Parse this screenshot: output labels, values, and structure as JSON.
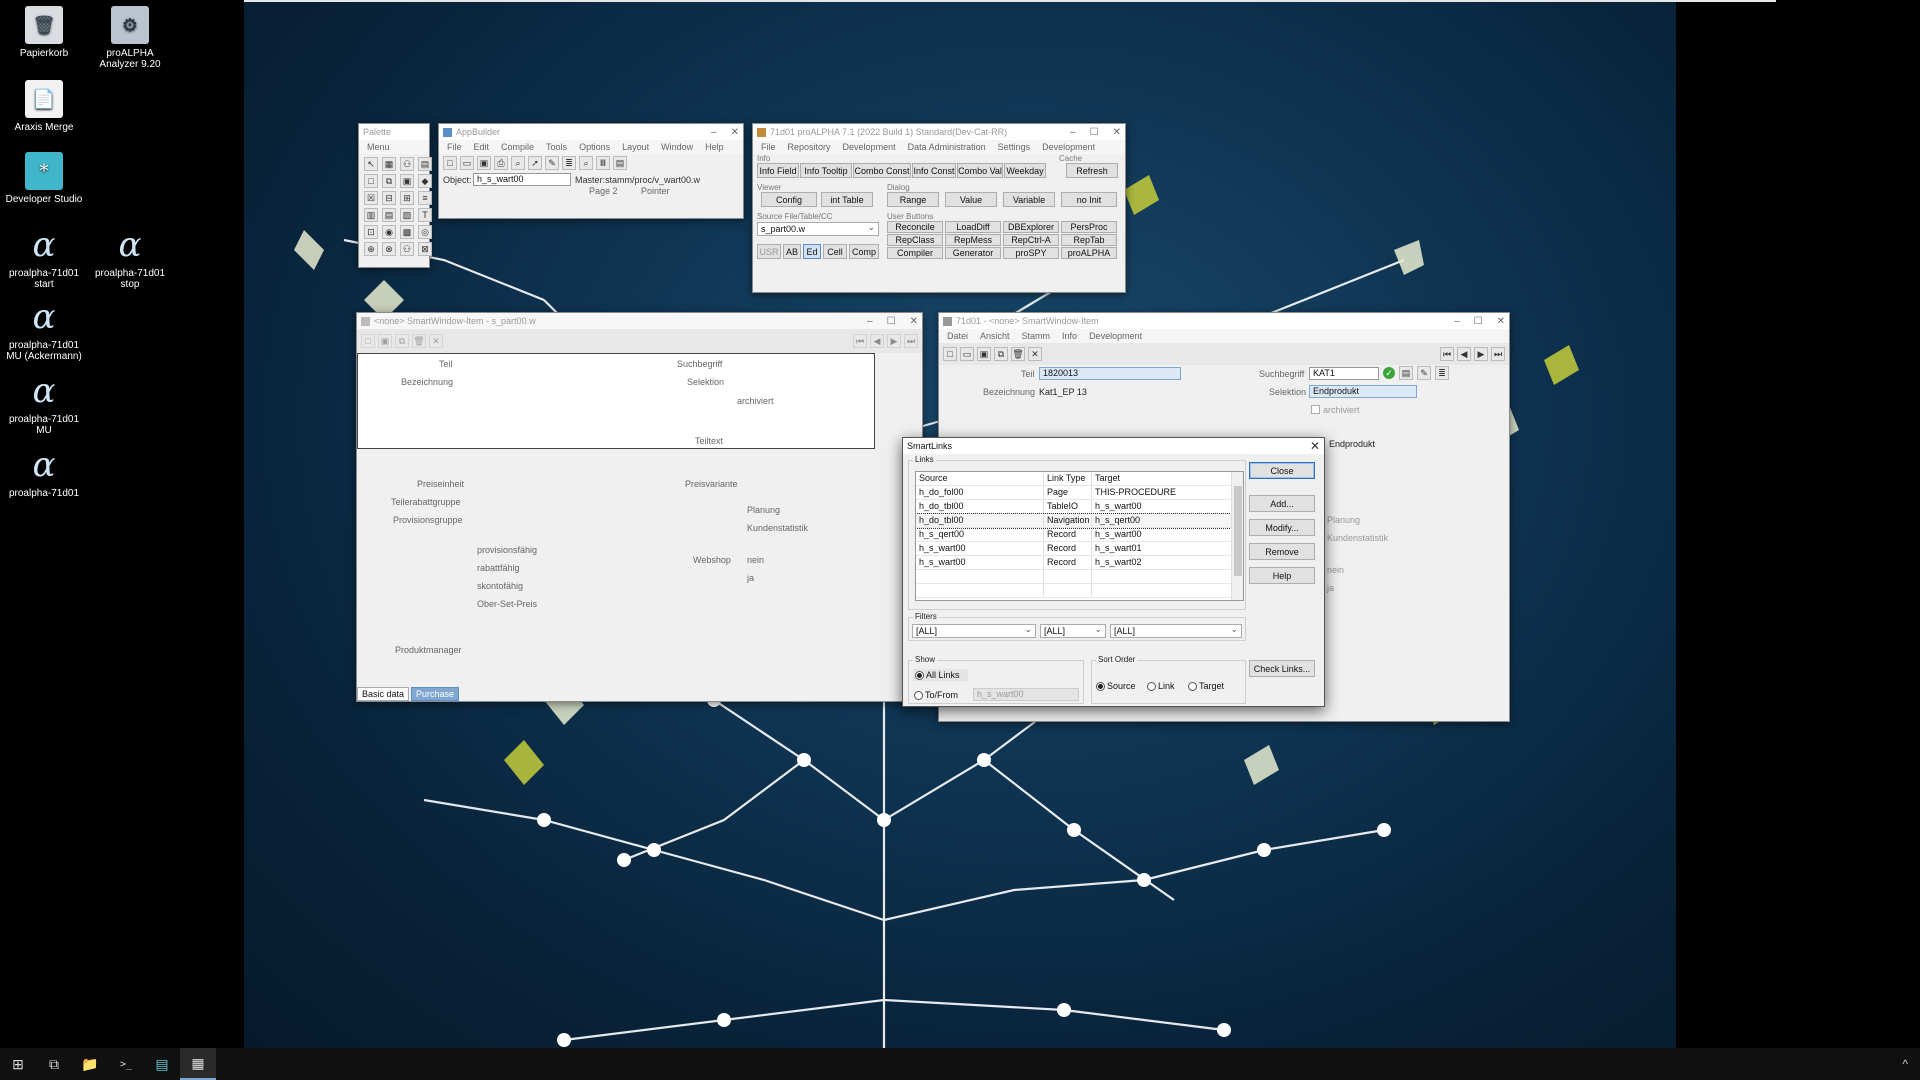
{
  "desktop_icons": [
    {
      "label": "Papierkorb",
      "icon": "recycle-bin-icon",
      "glyph": "🗑"
    },
    {
      "label": "proALPHA Analyzer 9.20",
      "icon": "analyzer-icon",
      "glyph": "⚙"
    },
    {
      "label": "Araxis Merge",
      "icon": "document-icon",
      "glyph": "📄"
    },
    {
      "label": "Developer Studio",
      "icon": "developer-studio-icon",
      "glyph": "*"
    },
    {
      "label": "proalpha-71d01 start",
      "icon": "proalpha-icon",
      "glyph": "α"
    },
    {
      "label": "proalpha-71d01 stop",
      "icon": "proalpha-icon",
      "glyph": "α"
    },
    {
      "label": "proalpha-71d01 MU (Ackermann)",
      "icon": "proalpha-icon",
      "glyph": "α"
    },
    {
      "label": "proalpha-71d01 MU",
      "icon": "proalpha-icon",
      "glyph": "α"
    },
    {
      "label": "proalpha-71d01",
      "icon": "proalpha-icon",
      "glyph": "α"
    }
  ],
  "palette": {
    "title": "Palette",
    "menu": "Menu"
  },
  "appbuilder": {
    "title": "AppBuilder",
    "menu": [
      "File",
      "Edit",
      "Compile",
      "Tools",
      "Options",
      "Layout",
      "Window",
      "Help"
    ],
    "object_label": "Object:",
    "object_value": "h_s_wart00",
    "master_label": "Master:",
    "master_value": "stamm/proc/v_wart00.w",
    "page_label": "Page 2",
    "pointer_label": "Pointer"
  },
  "dev_tool": {
    "title": "71d01 proALPHA 7.1 (2022 Build 1) Standard(Dev-Cat-RR)",
    "menu": [
      "File",
      "Repository",
      "Development",
      "Data Administration",
      "Settings",
      "Development"
    ],
    "info_label": "Info",
    "cache_label": "Cache",
    "info_buttons": [
      "Info Field",
      "Info Tooltip",
      "Combo Const",
      "Info Const",
      "Combo Val",
      "Weekday"
    ],
    "refresh": "Refresh",
    "viewer_label": "Viewer",
    "dialog_label": "Dialog",
    "viewer_buttons": [
      "Config",
      "int Table"
    ],
    "dialog_buttons": [
      "Range",
      "Value",
      "Variable",
      "no Init"
    ],
    "source_label": "Source File/Table/CC",
    "source_value": "s_part00.w",
    "user_buttons_label": "User Buttons",
    "user_buttons": [
      "Reconcile",
      "LoadDiff",
      "DBExplorer",
      "PersProc",
      "RepClass",
      "RepMess",
      "RepCtrl-A",
      "RepTab",
      "Compiler",
      "Generator",
      "proSPY",
      "proALPHA"
    ],
    "mini_buttons": [
      "USR",
      "AB",
      "Ed",
      "Cell",
      "Comp"
    ]
  },
  "left_window": {
    "title": "<none> SmartWindow-Item - s_part00.w",
    "labels": {
      "teil": "Teil",
      "bezeichnung": "Bezeichnung",
      "suchbegriff": "Suchbegriff",
      "selektion": "Selektion",
      "archiviert": "archiviert",
      "teiltext": "Teiltext",
      "preiseinheit": "Preiseinheit",
      "teilerabattgruppe": "Teilerabattgruppe",
      "provisionsgruppe": "Provisionsgruppe",
      "preisvariante": "Preisvariante",
      "planung": "Planung",
      "kundenstatistik": "Kundenstatistik",
      "provisionsfaehig": "provisionsfähig",
      "rabattfaehig": "rabattfähig",
      "skontofaehig": "skontofähig",
      "ober_set_preis": "Ober-Set-Preis",
      "webshop": "Webshop",
      "nein": "nein",
      "ja": "ja",
      "produktmanager": "Produktmanager"
    },
    "tabs": [
      "Basic data",
      "Purchase"
    ]
  },
  "right_window": {
    "title": "71d01 - <none> SmartWindow-Item",
    "menu": [
      "Datei",
      "Ansicht",
      "Stamm",
      "Info",
      "Development"
    ],
    "teil_label": "Teil",
    "teil_value": "1820013",
    "bezeichnung_label": "Bezeichnung",
    "bezeichnung_value": "Kat1_EP 13",
    "suchbegriff_label": "Suchbegriff",
    "suchbegriff_value": "KAT1",
    "selektion_label": "Selektion",
    "selektion_value": "Endprodukt",
    "archiviert": "archiviert",
    "endprodukt": "Endprodukt",
    "planung": "Planung",
    "kundenstatistik": "Kundenstatistik",
    "nein": "nein",
    "ja": "ja"
  },
  "smartlinks": {
    "title": "SmartLinks",
    "links_label": "Links",
    "columns": [
      "Source",
      "Link Type",
      "Target"
    ],
    "rows": [
      [
        "h_do_fol00",
        "Page",
        "THIS-PROCEDURE"
      ],
      [
        "h_do_tbl00",
        "TableIO",
        "h_s_wart00"
      ],
      [
        "h_do_tbl00",
        "Navigation",
        "h_s_qert00"
      ],
      [
        "h_s_qert00",
        "Record",
        "h_s_wart00"
      ],
      [
        "h_s_wart00",
        "Record",
        "h_s_wart01"
      ],
      [
        "h_s_wart00",
        "Record",
        "h_s_wart02"
      ]
    ],
    "selected_row": 2,
    "filters_label": "Filters",
    "filters": [
      "[ALL]",
      "[ALL]",
      "[ALL]"
    ],
    "show_label": "Show",
    "show_all": "All Links",
    "show_tofrom": "To/From",
    "tofrom_value": "h_s_wart00",
    "sort_label": "Sort Order",
    "sort_options": [
      "Source",
      "Link",
      "Target"
    ],
    "buttons": {
      "close": "Close",
      "add": "Add...",
      "modify": "Modify...",
      "remove": "Remove",
      "help": "Help",
      "check": "Check Links..."
    }
  },
  "taskbar": {
    "start": "⊞",
    "taskview": "⧉",
    "explorer": "📁",
    "terminal": ">_",
    "studio": "▤",
    "app": "▦",
    "tray": "^"
  }
}
